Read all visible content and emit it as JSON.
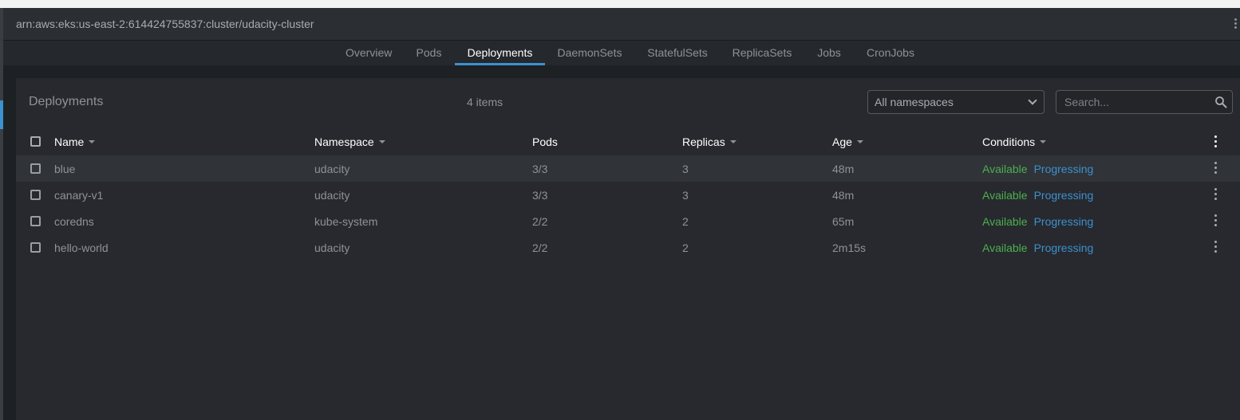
{
  "cluster": {
    "title": "arn:aws:eks:us-east-2:614424755837:cluster/udacity-cluster"
  },
  "tabs": [
    {
      "label": "Overview"
    },
    {
      "label": "Pods"
    },
    {
      "label": "Deployments",
      "active": true
    },
    {
      "label": "DaemonSets"
    },
    {
      "label": "StatefulSets"
    },
    {
      "label": "ReplicaSets"
    },
    {
      "label": "Jobs"
    },
    {
      "label": "CronJobs"
    }
  ],
  "panel": {
    "title": "Deployments",
    "items_count": "4 items",
    "namespace_select": {
      "value": "All namespaces"
    },
    "search": {
      "placeholder": "Search..."
    }
  },
  "table": {
    "columns": [
      "Name",
      "Namespace",
      "Pods",
      "Replicas",
      "Age",
      "Conditions"
    ],
    "rows": [
      {
        "name": "blue",
        "namespace": "udacity",
        "pods": "3/3",
        "replicas": "3",
        "age": "48m",
        "cond_available": "Available",
        "cond_progressing": "Progressing"
      },
      {
        "name": "canary-v1",
        "namespace": "udacity",
        "pods": "3/3",
        "replicas": "3",
        "age": "48m",
        "cond_available": "Available",
        "cond_progressing": "Progressing"
      },
      {
        "name": "coredns",
        "namespace": "kube-system",
        "pods": "2/2",
        "replicas": "2",
        "age": "65m",
        "cond_available": "Available",
        "cond_progressing": "Progressing"
      },
      {
        "name": "hello-world",
        "namespace": "udacity",
        "pods": "2/2",
        "replicas": "2",
        "age": "2m15s",
        "cond_available": "Available",
        "cond_progressing": "Progressing"
      }
    ]
  },
  "colors": {
    "accent": "#3d90ce",
    "available": "#4caf50",
    "progressing": "#3d90ce",
    "background": "#1e2124",
    "panel": "#27292e"
  },
  "icons": [
    "search-icon",
    "chevron-down-icon",
    "more-vertical-icon"
  ]
}
